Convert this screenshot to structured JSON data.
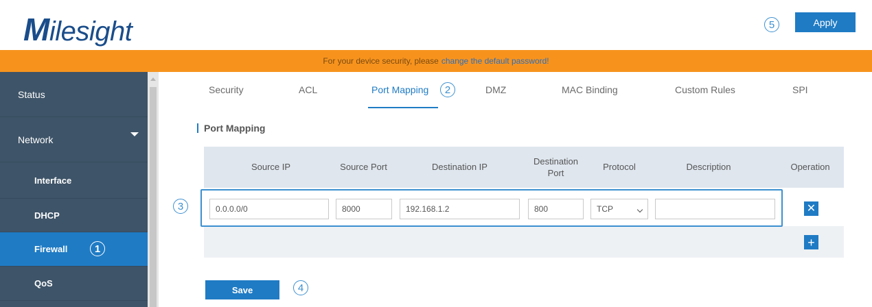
{
  "header": {
    "logo_initial": "M",
    "logo_rest": "ilesight",
    "apply_label": "Apply"
  },
  "banner": {
    "text": "For your device security, please",
    "link_text": "change the default password!"
  },
  "sidebar": {
    "items": [
      {
        "label": "Status",
        "type": "top"
      },
      {
        "label": "Network",
        "type": "top",
        "expanded": true
      },
      {
        "label": "Interface",
        "type": "sub"
      },
      {
        "label": "DHCP",
        "type": "sub"
      },
      {
        "label": "Firewall",
        "type": "sub",
        "active": true
      },
      {
        "label": "QoS",
        "type": "sub"
      }
    ]
  },
  "tabs": [
    {
      "label": "Security"
    },
    {
      "label": "ACL"
    },
    {
      "label": "Port Mapping",
      "active": true
    },
    {
      "label": "DMZ"
    },
    {
      "label": "MAC Binding"
    },
    {
      "label": "Custom Rules"
    },
    {
      "label": "SPI"
    }
  ],
  "section": {
    "title": "Port Mapping"
  },
  "table": {
    "columns": [
      "Source IP",
      "Source Port",
      "Destination IP",
      "Destination Port",
      "Protocol",
      "Description",
      "Operation"
    ],
    "rows": [
      {
        "source_ip": "0.0.0.0/0",
        "source_port": "8000",
        "destination_ip": "192.168.1.2",
        "destination_port": "800",
        "protocol": "TCP",
        "description": ""
      }
    ]
  },
  "buttons": {
    "save_label": "Save",
    "delete_symbol": "✕",
    "add_symbol": "+"
  },
  "callouts": [
    "1",
    "2",
    "3",
    "4",
    "5"
  ],
  "colors": {
    "brand_blue": "#1f7bc4",
    "banner_orange": "#f7931d",
    "sidebar_bg": "#3e5468",
    "callout_blue": "#3b8fd0"
  },
  "icons": {
    "delete": "close-icon",
    "add": "plus-icon",
    "network_expand": "caret-down-icon",
    "protocol_select": "chevron-down-icon"
  }
}
